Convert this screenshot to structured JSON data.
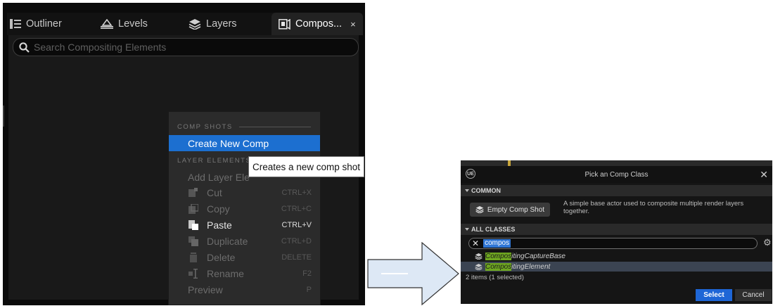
{
  "left_panel": {
    "tabs": [
      {
        "label": "Outliner",
        "icon": "outliner-icon"
      },
      {
        "label": "Levels",
        "icon": "levels-icon"
      },
      {
        "label": "Layers",
        "icon": "layers-icon"
      },
      {
        "label": "Compos...",
        "icon": "compositing-icon",
        "active": true,
        "close": "×"
      }
    ],
    "search": {
      "placeholder": "Search Compositing Elements",
      "value": ""
    },
    "context_menu": {
      "section_comp": "COMP SHOTS",
      "create_comp": "Create New Comp",
      "section_layer": "LAYER ELEMENTS",
      "add_layer": "Add Layer Ele",
      "items": [
        {
          "label": "Cut",
          "shortcut": "CTRL+X",
          "icon": "cut-icon",
          "enabled": false
        },
        {
          "label": "Copy",
          "shortcut": "CTRL+C",
          "icon": "copy-icon",
          "enabled": false
        },
        {
          "label": "Paste",
          "shortcut": "CTRL+V",
          "icon": "paste-icon",
          "enabled": true
        },
        {
          "label": "Duplicate",
          "shortcut": "CTRL+D",
          "icon": "duplicate-icon",
          "enabled": false
        },
        {
          "label": "Delete",
          "shortcut": "DELETE",
          "icon": "delete-icon",
          "enabled": false
        },
        {
          "label": "Rename",
          "shortcut": "F2",
          "icon": "rename-icon",
          "enabled": false
        },
        {
          "label": "Preview",
          "shortcut": "P",
          "icon": "",
          "enabled": false
        }
      ]
    },
    "tooltip": "Creates a new comp shot"
  },
  "dialog": {
    "title": "Pick an Comp Class",
    "close": "✕",
    "logo": "UE",
    "section_common": "COMMON",
    "empty_button": "Empty Comp Shot",
    "empty_description": "A simple base actor used to composite multiple render layers together.",
    "section_all": "ALL CLASSES",
    "search_value": "compos",
    "classes": [
      {
        "highlight": "Compos",
        "rest": "itingCaptureBase",
        "selected": false
      },
      {
        "highlight": "Compos",
        "rest": "itingElement",
        "selected": true
      }
    ],
    "selection_count": "2 items (1 selected)",
    "select_button": "Select",
    "cancel_button": "Cancel"
  },
  "colors": {
    "accent_blue": "#1c6fd0",
    "match_highlight": "#6ea620",
    "selected_row": "#3b4452",
    "arrow_fill": "#dde8f5",
    "arrow_stroke": "#333333"
  }
}
